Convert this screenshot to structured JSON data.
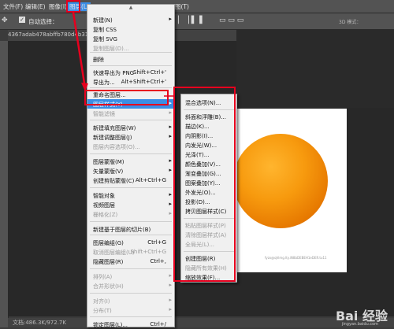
{
  "menubar": {
    "items": [
      {
        "label": "文件(F)"
      },
      {
        "label": "编辑(E)"
      },
      {
        "label": "图像(I)"
      },
      {
        "label": "图层(L)"
      },
      {
        "label": "图(T)"
      }
    ]
  },
  "optbar": {
    "auto_select": "自动选择：",
    "label_3d": "3D 模式："
  },
  "doc_tab": "4367adab478abffb780d4b31c8601",
  "status_text": "文档:486.3K/972.7K",
  "image_caption": "fyzx@qhlmg.lty.iN8bDEBEH1eDER.tu11",
  "layer_menu": {
    "items": [
      {
        "label": "新建(N)"
      },
      {
        "label": "复制 CSS"
      },
      {
        "label": "复制 SVG"
      },
      {
        "label": "复制图层(D)..."
      },
      {
        "label": "删除"
      },
      {
        "label": "快速导出为 PNG",
        "shortcut": "Shift+Ctrl+'"
      },
      {
        "label": "导出为...",
        "shortcut": "Alt+Shift+Ctrl+'"
      },
      {
        "label": "重命名图层..."
      },
      {
        "label": "图层样式(Y)"
      },
      {
        "label": "智能滤镜"
      },
      {
        "label": "新建填充图层(W)"
      },
      {
        "label": "新建调整图层(J)"
      },
      {
        "label": "图层内容选项(O)..."
      },
      {
        "label": "图层蒙版(M)"
      },
      {
        "label": "矢量蒙版(V)"
      },
      {
        "label": "创建剪贴蒙版(C)",
        "shortcut": "Alt+Ctrl+G"
      },
      {
        "label": "智能对象"
      },
      {
        "label": "视频图层"
      },
      {
        "label": "栅格化(Z)"
      },
      {
        "label": "新建基于图层的切片(B)"
      },
      {
        "label": "图层编组(G)",
        "shortcut": "Ctrl+G"
      },
      {
        "label": "取消图层编组(U)",
        "shortcut": "Shift+Ctrl+G"
      },
      {
        "label": "隐藏图层(R)",
        "shortcut": "Ctrl+,"
      },
      {
        "label": "排列(A)"
      },
      {
        "label": "合并形状(H)"
      },
      {
        "label": "对齐(I)"
      },
      {
        "label": "分布(T)"
      },
      {
        "label": "锁定图层(L)...",
        "shortcut": "Ctrl+/"
      }
    ]
  },
  "style_submenu": {
    "items": [
      {
        "label": "混合选项(N)..."
      },
      {
        "label": "斜面和浮雕(B)..."
      },
      {
        "label": "描边(K)..."
      },
      {
        "label": "内阴影(I)..."
      },
      {
        "label": "内发光(W)..."
      },
      {
        "label": "光泽(T)..."
      },
      {
        "label": "颜色叠加(V)..."
      },
      {
        "label": "渐变叠加(G)..."
      },
      {
        "label": "图案叠加(Y)..."
      },
      {
        "label": "外发光(O)..."
      },
      {
        "label": "投影(D)..."
      },
      {
        "label": "拷贝图层样式(C)"
      },
      {
        "label": "粘贴图层样式(P)"
      },
      {
        "label": "清除图层样式(A)"
      },
      {
        "label": "全局光(L)..."
      },
      {
        "label": "创建图层(R)"
      },
      {
        "label": "隐藏所有效果(H)"
      },
      {
        "label": "缩放效果(F)..."
      }
    ]
  },
  "watermark": {
    "text": "Bai 经验",
    "sub": "jingyan.baidu.com"
  },
  "colors": {
    "accent": "#3a8ee6",
    "annotation": "#e6001e",
    "menu_bg": "#f0f0f0"
  }
}
